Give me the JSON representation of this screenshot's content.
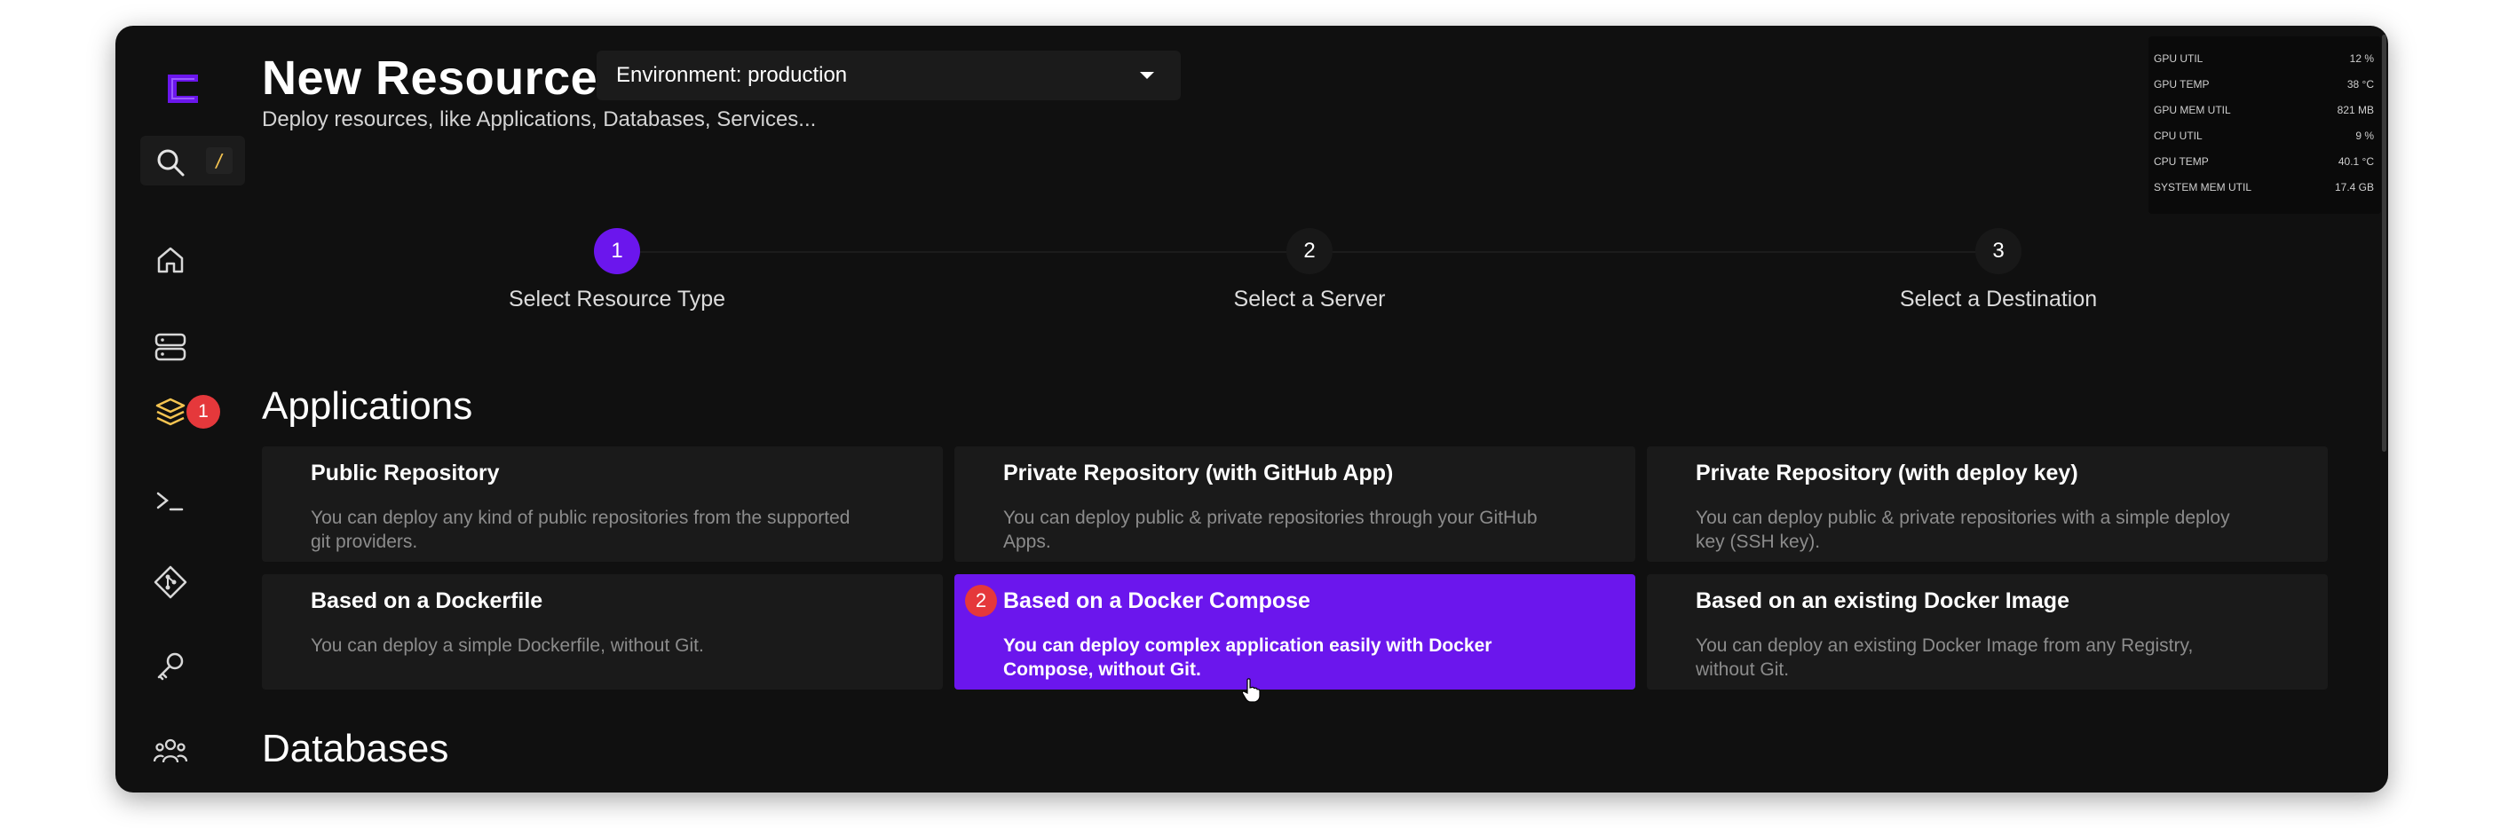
{
  "header": {
    "title": "New Resource",
    "subtitle": "Deploy resources, like Applications, Databases, Services...",
    "environment": "Environment: production"
  },
  "sidebar": {
    "search_shortcut": "/",
    "items": [
      {
        "name": "home",
        "icon": "home-icon"
      },
      {
        "name": "servers",
        "icon": "server-icon"
      },
      {
        "name": "projects",
        "icon": "layers-icon",
        "badge": "1"
      },
      {
        "name": "terminal",
        "icon": "terminal-icon"
      },
      {
        "name": "sources",
        "icon": "git-icon"
      },
      {
        "name": "keys",
        "icon": "key-icon"
      },
      {
        "name": "team",
        "icon": "team-icon"
      }
    ]
  },
  "metrics": [
    {
      "label": "GPU UTIL",
      "value": "12 %"
    },
    {
      "label": "GPU TEMP",
      "value": "38 °C"
    },
    {
      "label": "GPU MEM UTIL",
      "value": "821 MB"
    },
    {
      "label": "CPU UTIL",
      "value": "9 %"
    },
    {
      "label": "CPU TEMP",
      "value": "40.1 °C"
    },
    {
      "label": "SYSTEM MEM UTIL",
      "value": "17.4 GB"
    }
  ],
  "steps": [
    {
      "number": "1",
      "label": "Select Resource Type"
    },
    {
      "number": "2",
      "label": "Select a Server"
    },
    {
      "number": "3",
      "label": "Select a Destination"
    }
  ],
  "sections": {
    "applications": "Applications",
    "databases": "Databases"
  },
  "cards": [
    {
      "title": "Public Repository",
      "desc": "You can deploy any kind of public repositories from the supported git providers."
    },
    {
      "title": "Private Repository (with GitHub App)",
      "desc": "You can deploy public & private repositories through your GitHub Apps."
    },
    {
      "title": "Private Repository (with deploy key)",
      "desc": "You can deploy public & private repositories with a simple deploy key (SSH key)."
    },
    {
      "title": "Based on a Dockerfile",
      "desc": "You can deploy a simple Dockerfile, without Git."
    },
    {
      "title": "Based on a Docker Compose",
      "desc": "You can deploy complex application easily with Docker Compose, without Git.",
      "badge": "2"
    },
    {
      "title": "Based on an existing Docker Image",
      "desc": "You can deploy an existing Docker Image from any Registry, without Git."
    }
  ],
  "colors": {
    "accent": "#6b16ed",
    "badge": "#e5383b",
    "background": "#101010",
    "card": "#1a1a1a"
  }
}
